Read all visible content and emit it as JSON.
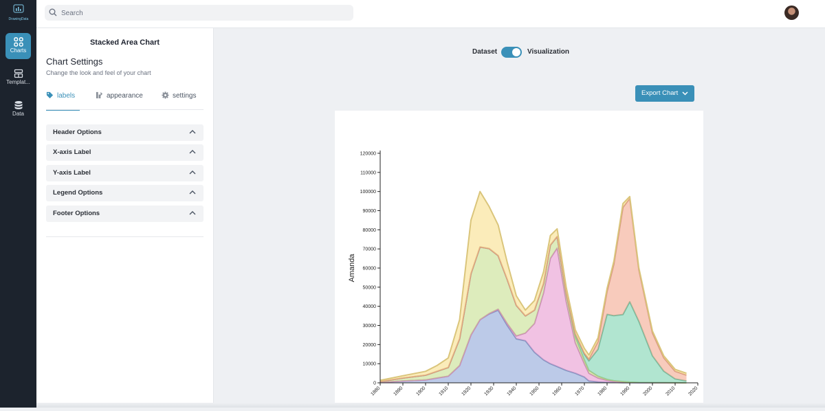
{
  "app": {
    "logo_text": "DrawingData"
  },
  "rail": {
    "items": [
      {
        "label": "Charts",
        "icon": "grid-icon",
        "active": true
      },
      {
        "label": "Templat...",
        "icon": "template-icon",
        "active": false
      },
      {
        "label": "Data",
        "icon": "database-icon",
        "active": false
      }
    ]
  },
  "search": {
    "placeholder": "Search",
    "value": ""
  },
  "panel": {
    "title": "Stacked Area Chart",
    "settings_title": "Chart Settings",
    "settings_subtitle": "Change the look and feel of your chart",
    "tabs": [
      {
        "label": "labels",
        "icon": "tag-icon",
        "active": true
      },
      {
        "label": "appearance",
        "icon": "appearance-icon",
        "active": false
      },
      {
        "label": "settings",
        "icon": "gear-icon",
        "active": false
      }
    ],
    "accordions": [
      "Header Options",
      "X-axis Label",
      "Y-axis Label",
      "Legend Options",
      "Footer Options"
    ]
  },
  "view_toggle": {
    "left_label": "Dataset",
    "right_label": "Visualization",
    "value": "Visualization"
  },
  "export_button": {
    "label": "Export Chart"
  },
  "colors": {
    "accent": "#3a90b8",
    "rail": "#1c232d"
  },
  "chart_data": {
    "type": "area",
    "stacked": true,
    "ylabel": "Amanda",
    "xlabel": "",
    "xlim": [
      1880,
      2020
    ],
    "ylim": [
      0,
      120000
    ],
    "x_ticks": [
      1880,
      1890,
      1900,
      1910,
      1920,
      1930,
      1940,
      1950,
      1960,
      1970,
      1980,
      1990,
      2000,
      2010,
      2020
    ],
    "y_ticks": [
      0,
      10000,
      20000,
      30000,
      40000,
      50000,
      60000,
      70000,
      80000,
      90000,
      100000,
      110000,
      120000
    ],
    "x": [
      1880,
      1890,
      1900,
      1905,
      1910,
      1915,
      1920,
      1924,
      1928,
      1932,
      1936,
      1940,
      1944,
      1948,
      1952,
      1955,
      1958,
      1962,
      1966,
      1970,
      1972,
      1976,
      1980,
      1983,
      1987,
      1990,
      1994,
      2000,
      2005,
      2010,
      2015
    ],
    "series": [
      {
        "color": "#8fa7d8",
        "values": [
          200,
          1000,
          1500,
          2500,
          3500,
          9000,
          25000,
          33000,
          36000,
          38000,
          30000,
          23000,
          22000,
          16000,
          12000,
          10000,
          8500,
          6500,
          5000,
          3000,
          1000,
          500,
          300,
          200,
          100,
          80,
          50,
          30,
          20,
          10,
          0
        ]
      },
      {
        "color": "#e79ad0",
        "values": [
          0,
          0,
          0,
          0,
          0,
          0,
          0,
          0,
          200,
          500,
          1000,
          1500,
          4000,
          15000,
          35000,
          55000,
          62000,
          36000,
          16000,
          7000,
          4000,
          2000,
          1000,
          600,
          400,
          200,
          100,
          50,
          30,
          20,
          10
        ]
      },
      {
        "color": "#c7e08f",
        "values": [
          500,
          1500,
          2500,
          3500,
          4500,
          14000,
          32000,
          38000,
          34000,
          28000,
          23000,
          16000,
          9000,
          7000,
          5000,
          7000,
          6000,
          4000,
          3000,
          2000,
          1500,
          1000,
          500,
          300,
          200,
          100,
          50,
          30,
          20,
          10,
          0
        ]
      },
      {
        "color": "#7dd3b0",
        "values": [
          0,
          0,
          0,
          0,
          0,
          0,
          0,
          0,
          0,
          0,
          0,
          0,
          0,
          0,
          0,
          0,
          0,
          500,
          1500,
          3000,
          5000,
          14000,
          34000,
          34000,
          35000,
          42000,
          32000,
          14000,
          6000,
          2000,
          1000
        ]
      },
      {
        "color": "#f4a890",
        "values": [
          0,
          0,
          0,
          0,
          0,
          0,
          0,
          0,
          0,
          0,
          0,
          0,
          0,
          0,
          0,
          0,
          0,
          0,
          200,
          500,
          1000,
          4000,
          12000,
          27000,
          56000,
          54000,
          27000,
          12000,
          7000,
          4000,
          3000
        ]
      },
      {
        "color": "#f8e08c",
        "values": [
          600,
          1200,
          2000,
          3000,
          5000,
          10000,
          28000,
          29000,
          22000,
          16000,
          9000,
          5000,
          3000,
          5000,
          6000,
          5000,
          4000,
          3000,
          2000,
          2500,
          2000,
          2000,
          1500,
          1500,
          2000,
          1000,
          1000,
          1000,
          1000,
          1000,
          1000
        ]
      }
    ]
  }
}
